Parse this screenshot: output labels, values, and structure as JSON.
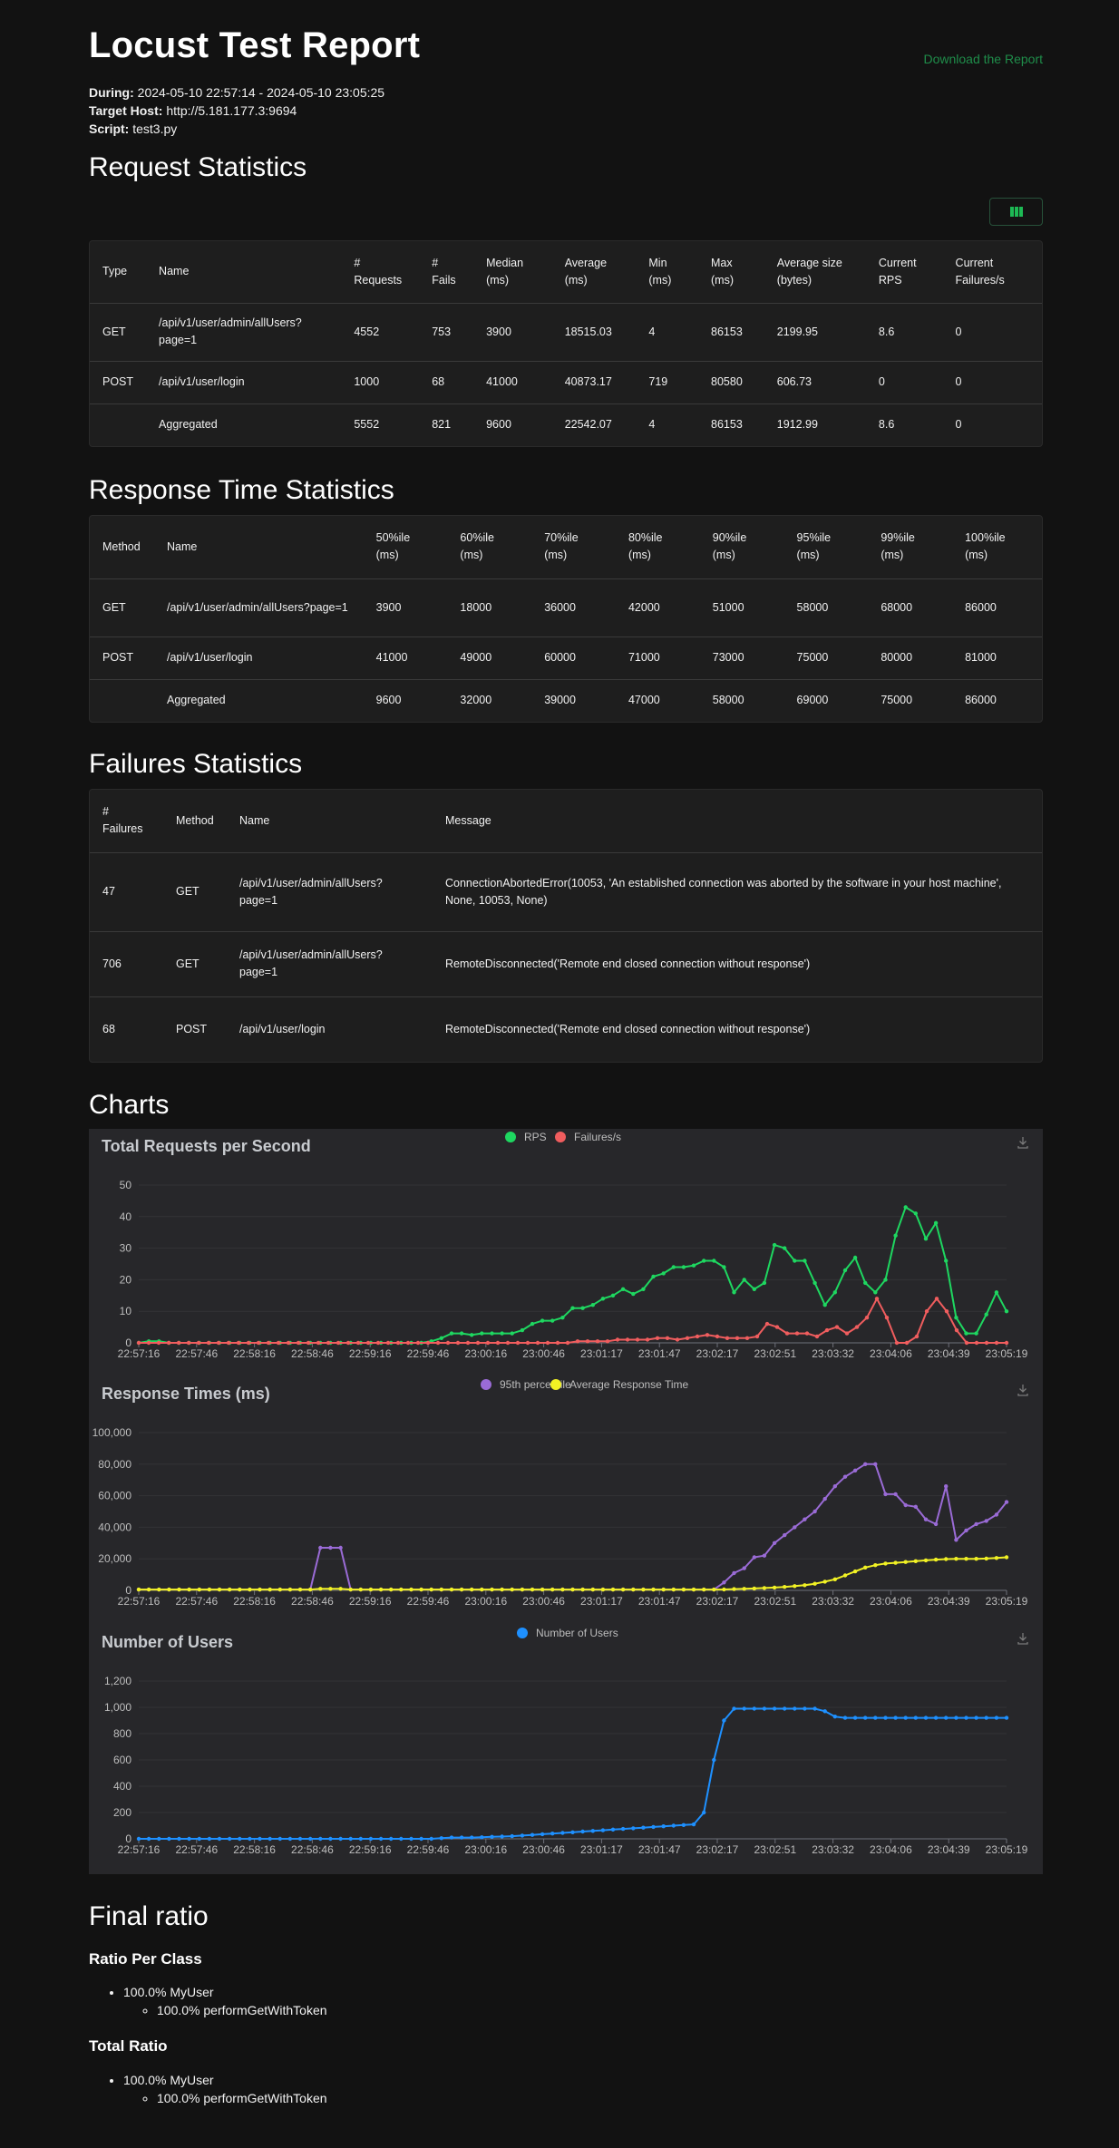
{
  "header": {
    "title": "Locust Test Report",
    "download_label": "Download the Report",
    "during_label": "During:",
    "during_value": "2024-05-10 22:57:14 - 2024-05-10 23:05:25",
    "host_label": "Target Host:",
    "host_value": "http://5.181.177.3:9694",
    "script_label": "Script:",
    "script_value": "test3.py"
  },
  "request_statistics": {
    "title": "Request Statistics",
    "columns": [
      "Type",
      "Name",
      "# Requests",
      "# Fails",
      "Median (ms)",
      "Average (ms)",
      "Min (ms)",
      "Max (ms)",
      "Average size (bytes)",
      "Current RPS",
      "Current Failures/s"
    ],
    "rows": [
      [
        "GET",
        "/api/v1/user/admin/allUsers?page=1",
        "4552",
        "753",
        "3900",
        "18515.03",
        "4",
        "86153",
        "2199.95",
        "8.6",
        "0"
      ],
      [
        "POST",
        "/api/v1/user/login",
        "1000",
        "68",
        "41000",
        "40873.17",
        "719",
        "80580",
        "606.73",
        "0",
        "0"
      ],
      [
        "",
        "Aggregated",
        "5552",
        "821",
        "9600",
        "22542.07",
        "4",
        "86153",
        "1912.99",
        "8.6",
        "0"
      ]
    ]
  },
  "response_time_statistics": {
    "title": "Response Time Statistics",
    "columns": [
      "Method",
      "Name",
      "50%ile (ms)",
      "60%ile (ms)",
      "70%ile (ms)",
      "80%ile (ms)",
      "90%ile (ms)",
      "95%ile (ms)",
      "99%ile (ms)",
      "100%ile (ms)"
    ],
    "rows": [
      [
        "GET",
        "/api/v1/user/admin/allUsers?page=1",
        "3900",
        "18000",
        "36000",
        "42000",
        "51000",
        "58000",
        "68000",
        "86000"
      ],
      [
        "POST",
        "/api/v1/user/login",
        "41000",
        "49000",
        "60000",
        "71000",
        "73000",
        "75000",
        "80000",
        "81000"
      ],
      [
        "",
        "Aggregated",
        "9600",
        "32000",
        "39000",
        "47000",
        "58000",
        "69000",
        "75000",
        "86000"
      ]
    ]
  },
  "failures_statistics": {
    "title": "Failures Statistics",
    "columns": [
      "# Failures",
      "Method",
      "Name",
      "Message"
    ],
    "rows": [
      [
        "47",
        "GET",
        "/api/v1/user/admin/allUsers?page=1",
        "ConnectionAbortedError(10053, 'An established connection was aborted by the software in your host machine', None, 10053, None)"
      ],
      [
        "706",
        "GET",
        "/api/v1/user/admin/allUsers?page=1",
        "RemoteDisconnected('Remote end closed connection without response')"
      ],
      [
        "68",
        "POST",
        "/api/v1/user/login",
        "RemoteDisconnected('Remote end closed connection without response')"
      ]
    ]
  },
  "charts_title": "Charts",
  "chart_data": [
    {
      "type": "line",
      "title": "Total Requests per Second",
      "x_tick_labels": [
        "22:57:16",
        "22:57:46",
        "22:58:16",
        "22:58:46",
        "22:59:16",
        "22:59:46",
        "23:00:16",
        "23:00:46",
        "23:01:17",
        "23:01:47",
        "23:02:17",
        "23:02:51",
        "23:03:32",
        "23:04:06",
        "23:04:39",
        "23:05:19"
      ],
      "ylim": [
        0,
        50
      ],
      "y_ticks": [
        0,
        10,
        20,
        30,
        40,
        50
      ],
      "legend_position": "top-center",
      "series": [
        {
          "name": "RPS",
          "color": "#1ed760",
          "values": [
            0,
            0.5,
            0.5,
            0,
            0,
            0,
            0,
            0,
            0,
            0,
            0,
            0,
            0,
            0,
            0,
            0,
            0,
            0,
            0,
            0,
            0,
            0,
            0,
            0,
            0,
            0,
            0,
            0,
            0,
            0.5,
            1.5,
            3,
            3,
            2.5,
            3,
            3,
            3,
            3,
            4,
            6,
            7,
            7,
            8,
            11,
            11,
            12,
            14,
            15,
            17,
            15.5,
            17,
            21,
            22,
            24,
            24,
            24.5,
            26,
            26,
            24,
            16,
            20,
            17,
            19,
            31,
            30,
            26,
            26,
            19,
            12,
            16,
            23,
            27,
            19,
            16,
            20,
            34,
            43,
            41,
            33,
            38,
            26,
            8,
            3,
            3,
            9,
            16,
            10
          ]
        },
        {
          "name": "Failures/s",
          "color": "#f05d5e",
          "values": [
            0,
            0,
            0,
            0,
            0,
            0,
            0,
            0,
            0,
            0,
            0,
            0,
            0,
            0,
            0,
            0,
            0,
            0,
            0,
            0,
            0,
            0,
            0,
            0,
            0,
            0,
            0,
            0,
            0,
            0,
            0,
            0,
            0,
            0,
            0,
            0,
            0,
            0,
            0,
            0,
            0,
            0,
            0,
            0,
            0.5,
            0.5,
            0.5,
            0.5,
            1,
            1,
            1,
            1,
            1.5,
            1.5,
            1,
            1.5,
            2,
            2.5,
            2,
            1.5,
            1.5,
            1.5,
            2,
            6,
            5,
            3,
            3,
            3,
            2,
            4,
            5,
            3,
            5,
            8,
            14,
            8,
            0,
            0,
            2,
            10,
            14,
            10,
            4,
            0,
            0,
            0,
            0,
            0
          ]
        }
      ]
    },
    {
      "type": "line",
      "title": "Response Times (ms)",
      "x_tick_labels": [
        "22:57:16",
        "22:57:46",
        "22:58:16",
        "22:58:46",
        "22:59:16",
        "22:59:46",
        "23:00:16",
        "23:00:46",
        "23:01:17",
        "23:01:47",
        "23:02:17",
        "23:02:51",
        "23:03:32",
        "23:04:06",
        "23:04:39",
        "23:05:19"
      ],
      "ylim": [
        0,
        100000
      ],
      "y_ticks": [
        "0",
        "20,000",
        "40,000",
        "60,000",
        "80,000",
        "100,000"
      ],
      "legend_position": "top-center",
      "series": [
        {
          "name": "95th percentile",
          "color": "#9a6bd6",
          "values": [
            500,
            500,
            500,
            500,
            500,
            500,
            500,
            500,
            500,
            500,
            500,
            500,
            500,
            500,
            500,
            500,
            500,
            500,
            27000,
            27000,
            27000,
            500,
            500,
            500,
            500,
            500,
            500,
            500,
            500,
            500,
            500,
            500,
            500,
            500,
            500,
            500,
            500,
            500,
            500,
            500,
            500,
            500,
            500,
            500,
            500,
            500,
            500,
            500,
            500,
            500,
            500,
            500,
            500,
            500,
            500,
            500,
            500,
            500,
            5000,
            11000,
            14000,
            21000,
            22000,
            30000,
            35000,
            40000,
            45000,
            50000,
            58000,
            66000,
            72000,
            76000,
            80000,
            80000,
            61000,
            61000,
            54000,
            53000,
            45000,
            42000,
            66000,
            32000,
            38000,
            42000,
            44000,
            48000,
            56000
          ]
        },
        {
          "name": "Average Response Time",
          "color": "#f2f224",
          "values": [
            500,
            500,
            500,
            500,
            500,
            500,
            500,
            500,
            500,
            500,
            500,
            500,
            500,
            500,
            500,
            500,
            500,
            500,
            1000,
            1000,
            1000,
            500,
            500,
            500,
            500,
            500,
            500,
            500,
            500,
            500,
            500,
            500,
            500,
            500,
            500,
            500,
            500,
            500,
            500,
            500,
            500,
            500,
            500,
            500,
            500,
            500,
            500,
            500,
            500,
            500,
            500,
            500,
            500,
            500,
            500,
            500,
            500,
            500,
            600,
            800,
            1000,
            1200,
            1500,
            1800,
            2200,
            2700,
            3300,
            4200,
            5500,
            7000,
            9500,
            12000,
            14500,
            16000,
            17000,
            17500,
            18000,
            18500,
            19000,
            19500,
            19800,
            20000,
            20000,
            20000,
            20200,
            20500,
            21000
          ]
        }
      ]
    },
    {
      "type": "line",
      "title": "Number of Users",
      "x_tick_labels": [
        "22:57:16",
        "22:57:46",
        "22:58:16",
        "22:58:46",
        "22:59:16",
        "22:59:46",
        "23:00:16",
        "23:00:46",
        "23:01:17",
        "23:01:47",
        "23:02:17",
        "23:02:51",
        "23:03:32",
        "23:04:06",
        "23:04:39",
        "23:05:19"
      ],
      "ylim": [
        0,
        1200
      ],
      "y_ticks": [
        "0",
        "200",
        "400",
        "600",
        "800",
        "1,000",
        "1,200"
      ],
      "legend_position": "top-center",
      "series": [
        {
          "name": "Number of Users",
          "color": "#1e90ff",
          "values": [
            0,
            0,
            0,
            0,
            0,
            0,
            0,
            0,
            0,
            0,
            0,
            0,
            0,
            0,
            0,
            0,
            0,
            0,
            0,
            0,
            0,
            0,
            0,
            0,
            0,
            0,
            0,
            0,
            0,
            0,
            5,
            10,
            10,
            10,
            12,
            15,
            17,
            20,
            25,
            30,
            35,
            40,
            45,
            50,
            55,
            60,
            65,
            70,
            75,
            80,
            85,
            90,
            95,
            100,
            105,
            110,
            200,
            600,
            900,
            990,
            990,
            990,
            990,
            990,
            990,
            990,
            990,
            990,
            970,
            930,
            920,
            920,
            920,
            920,
            920,
            920,
            920,
            920,
            920,
            920,
            920,
            920,
            920,
            920,
            920,
            920,
            920
          ]
        }
      ]
    }
  ],
  "final_ratio": {
    "title": "Final ratio",
    "per_class_title": "Ratio Per Class",
    "per_class_user": "100.0% MyUser",
    "per_class_task": "100.0% performGetWithToken",
    "total_title": "Total Ratio",
    "total_user": "100.0% MyUser",
    "total_task": "100.0% performGetWithToken"
  },
  "icons": {
    "column_toggle": "columns-icon",
    "chart_download": "download-icon"
  },
  "colors": {
    "background": "#121212",
    "table_bg": "#1e1e1e",
    "chart_bg": "#27272a",
    "link": "#1f8d4a"
  }
}
